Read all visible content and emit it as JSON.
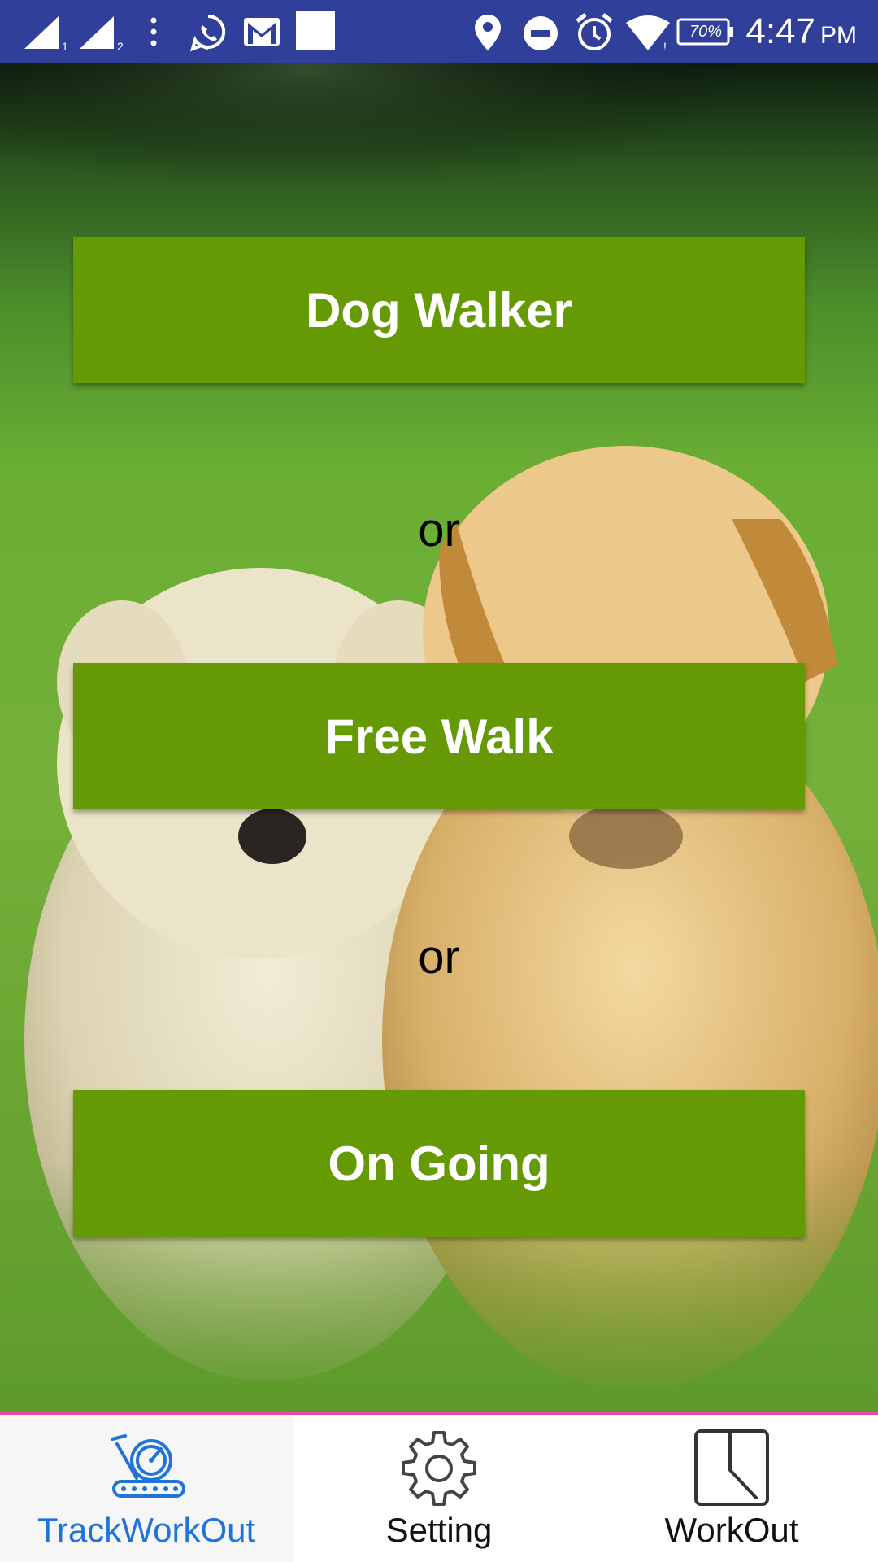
{
  "status_bar": {
    "time": "4:47",
    "ampm": "PM",
    "battery_level": "70%",
    "icons": [
      "signal-sim1-icon",
      "signal-sim2-icon",
      "more-vert-icon",
      "whatsapp-icon",
      "gmail-icon",
      "notification-square-icon",
      "location-icon",
      "do-not-disturb-icon",
      "alarm-icon",
      "wifi-icon",
      "battery-icon"
    ],
    "bar_color": "#2f3f9a"
  },
  "main": {
    "buttons": [
      {
        "label": "Dog Walker"
      },
      {
        "label": "Free Walk"
      },
      {
        "label": "On Going"
      }
    ],
    "separator_text": "or",
    "button_color": "#669a04"
  },
  "bottom_nav": {
    "items": [
      {
        "label": "TrackWorkOut",
        "icon": "treadmill-gauge-icon",
        "active": true
      },
      {
        "label": "Setting",
        "icon": "gear-icon",
        "active": false
      },
      {
        "label": "WorkOut",
        "icon": "clock-icon",
        "active": false
      }
    ],
    "active_color": "#1f73d9",
    "divider_color": "#e14cab"
  }
}
